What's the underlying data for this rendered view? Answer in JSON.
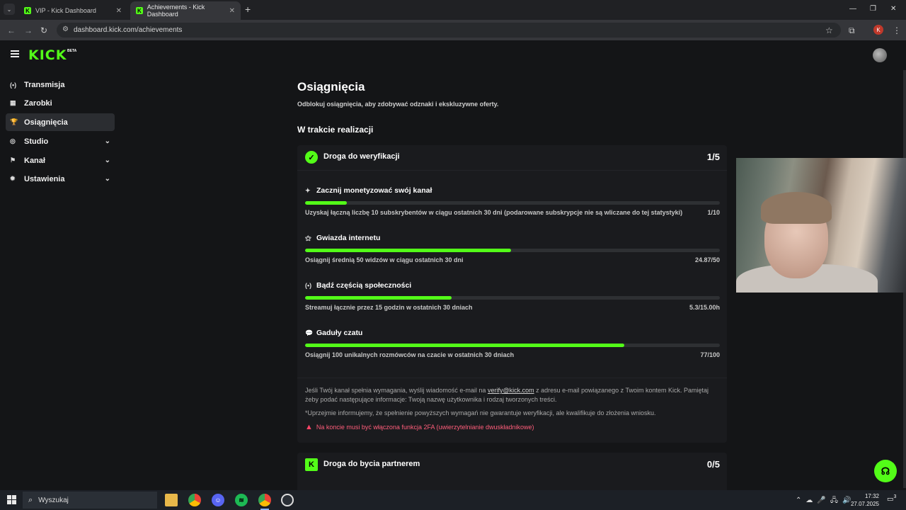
{
  "browser": {
    "tabs": [
      {
        "title": "VIP - Kick Dashboard",
        "active": false
      },
      {
        "title": "Achievements - Kick Dashboard",
        "active": true
      }
    ],
    "url": "dashboard.kick.com/achievements"
  },
  "header": {
    "logo": "KICK",
    "logo_badge": "BETA"
  },
  "sidebar": {
    "items": [
      {
        "label": "Transmisja",
        "icon": "broadcast-icon",
        "glyph": "(•)",
        "expandable": false,
        "active": false
      },
      {
        "label": "Zarobki",
        "icon": "earnings-icon",
        "glyph": "▦",
        "expandable": false,
        "active": false
      },
      {
        "label": "Osiągnięcia",
        "icon": "trophy-icon",
        "glyph": "🏆",
        "expandable": false,
        "active": true
      },
      {
        "label": "Studio",
        "icon": "studio-icon",
        "glyph": "◎",
        "expandable": true,
        "active": false
      },
      {
        "label": "Kanał",
        "icon": "channel-icon",
        "glyph": "⚑",
        "expandable": true,
        "active": false
      },
      {
        "label": "Ustawienia",
        "icon": "settings-icon",
        "glyph": "✹",
        "expandable": true,
        "active": false
      }
    ]
  },
  "main": {
    "title": "Osiągnięcia",
    "subtitle": "Odblokuj osiągnięcia, aby zdobywać odznaki i ekskluzywne oferty.",
    "section_heading": "W trakcie realizacji",
    "cards": [
      {
        "title": "Droga do weryfikacji",
        "count": "1/5",
        "icon": "verified-badge-icon",
        "goals": [
          {
            "title": "Zacznij monetyzować swój kanał",
            "icon": "sparkle-icon",
            "glyph": "✦",
            "desc": "Uzyskaj łączną liczbę 10 subskrybentów w ciągu ostatnich 30 dni (podarowane subskrypcje nie są wliczane do tej statystyki)",
            "value": "1/10",
            "progress": 0.1
          },
          {
            "title": "Gwiazda internetu",
            "icon": "star-people-icon",
            "glyph": "⚝",
            "desc": "Osiągnij średnią 50 widzów w ciągu ostatnich 30 dni",
            "value": "24.87/50",
            "progress": 0.4974
          },
          {
            "title": "Bądź częścią społeczności",
            "icon": "broadcast-icon",
            "glyph": "(•)",
            "desc": "Streamuj łącznie przez 15 godzin w ostatnich 30 dniach",
            "value": "5.3/15.00h",
            "progress": 0.3533
          },
          {
            "title": "Gaduły czatu",
            "icon": "chat-icon",
            "glyph": "💬",
            "desc": "Osiągnij 100 unikalnych rozmówców na czacie w ostatnich 30 dniach",
            "value": "77/100",
            "progress": 0.77
          }
        ],
        "info_prefix": "Jeśli Twój kanał spełnia wymagania, wyślij wiadomość e-mail na ",
        "info_link": "verify@kick.com",
        "info_suffix": " z adresu e-mail powiązanego z Twoim kontem Kick. Pamiętaj żeby podać następujące informacje: Twoją nazwę użytkownika i rodzaj tworzonych treści.",
        "disclaimer": "*Uprzejmie informujemy, że spełnienie powyższych wymagań nie gwarantuje weryfikacji, ale kwalifikuje do złożenia wniosku.",
        "warning": "Na koncie musi być włączona funkcja 2FA (uwierzytelnianie dwuskładnikowe)"
      },
      {
        "title": "Droga do bycia partnerem",
        "count": "0/5",
        "icon": "kick-logo-icon"
      }
    ]
  },
  "taskbar": {
    "search_placeholder": "Wyszukaj",
    "time": "17:32",
    "date": "27.07.2025",
    "notification_count": "3"
  },
  "colors": {
    "accent": "#53fc18",
    "warning": "#ff5d7a",
    "background": "#141517"
  }
}
